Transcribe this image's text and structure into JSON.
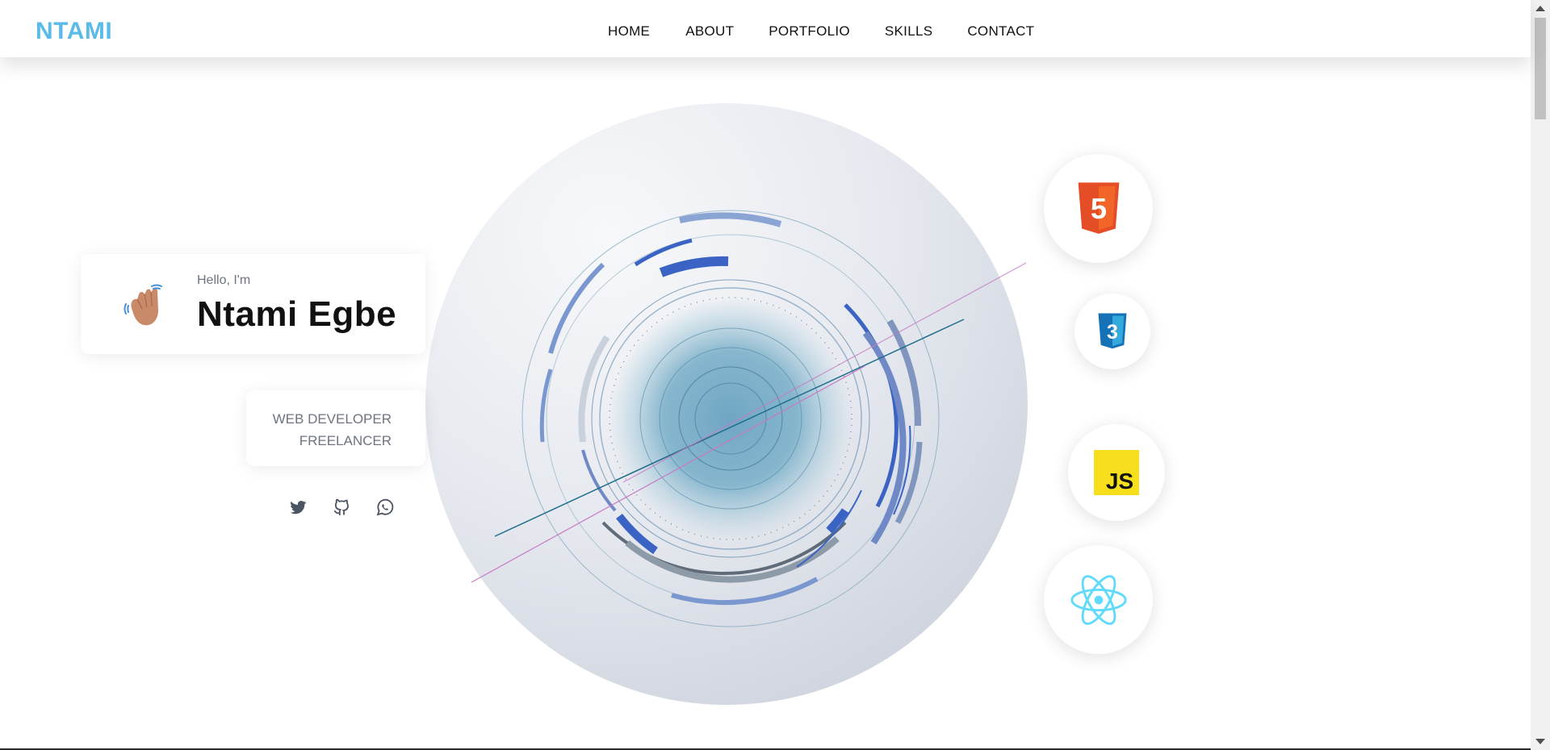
{
  "brand": {
    "logo_text": "NTAMI"
  },
  "nav": {
    "items": [
      {
        "label": "HOME"
      },
      {
        "label": "ABOUT"
      },
      {
        "label": "PORTFOLIO"
      },
      {
        "label": "SKILLS"
      },
      {
        "label": "CONTACT"
      }
    ]
  },
  "intro": {
    "greeting": "Hello, I'm",
    "name": "Ntami Egbe",
    "wave_icon": "waving-hand-icon",
    "roles": [
      "WEB DEVELOPER",
      "FREELANCER"
    ]
  },
  "socials": [
    {
      "icon": "twitter-icon"
    },
    {
      "icon": "github-icon"
    },
    {
      "icon": "whatsapp-icon"
    }
  ],
  "skills": [
    {
      "icon": "html5-icon",
      "label": "5"
    },
    {
      "icon": "css3-icon",
      "label": "3"
    },
    {
      "icon": "javascript-icon",
      "label": "JS"
    },
    {
      "icon": "react-icon"
    }
  ],
  "colors": {
    "brand": "#5bbbe8",
    "text_dark": "#111111",
    "text_muted": "#6d7582",
    "html_orange": "#e44d26",
    "css_blue": "#1572b6",
    "js_yellow": "#f7df1e",
    "react_cyan": "#61dafb"
  }
}
